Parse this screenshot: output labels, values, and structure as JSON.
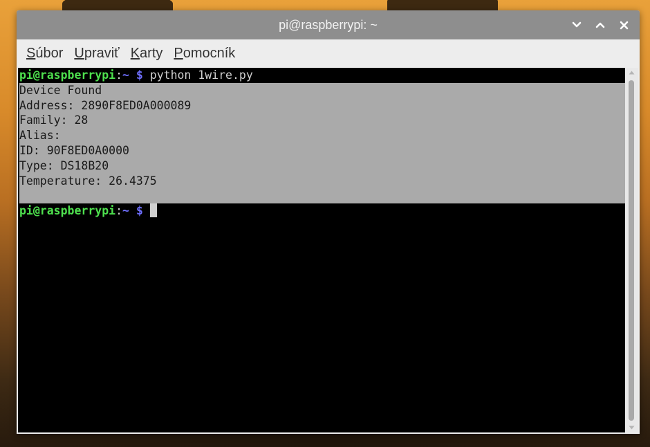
{
  "window": {
    "title": "pi@raspberrypi: ~"
  },
  "menu": {
    "items": [
      {
        "mnemonic": "S",
        "rest": "úbor"
      },
      {
        "mnemonic": "U",
        "rest": "praviť"
      },
      {
        "mnemonic": "K",
        "rest": "arty"
      },
      {
        "mnemonic": "P",
        "rest": "omocník"
      }
    ]
  },
  "terminal": {
    "prompt": {
      "user_host": "pi@raspberrypi",
      "colon": ":",
      "path": "~",
      "dollar": " $ "
    },
    "command": "python 1wire.py",
    "output": [
      "Device Found",
      "Address: 2890F8ED0A000089",
      "Family: 28",
      "Alias:",
      "ID: 90F8ED0A0000",
      "Type: DS18B20",
      "Temperature: 26.4375",
      ""
    ]
  },
  "colors": {
    "titlebar": "#8e8e8e",
    "prompt_user": "#4ee04e",
    "prompt_path": "#6f6fff",
    "selection": "#aaaaaa"
  },
  "icons": {
    "minimize": "chevron-down-icon",
    "maximize": "chevron-up-icon",
    "close": "close-icon",
    "scroll_up": "triangle-up-icon",
    "scroll_down": "triangle-down-icon"
  }
}
